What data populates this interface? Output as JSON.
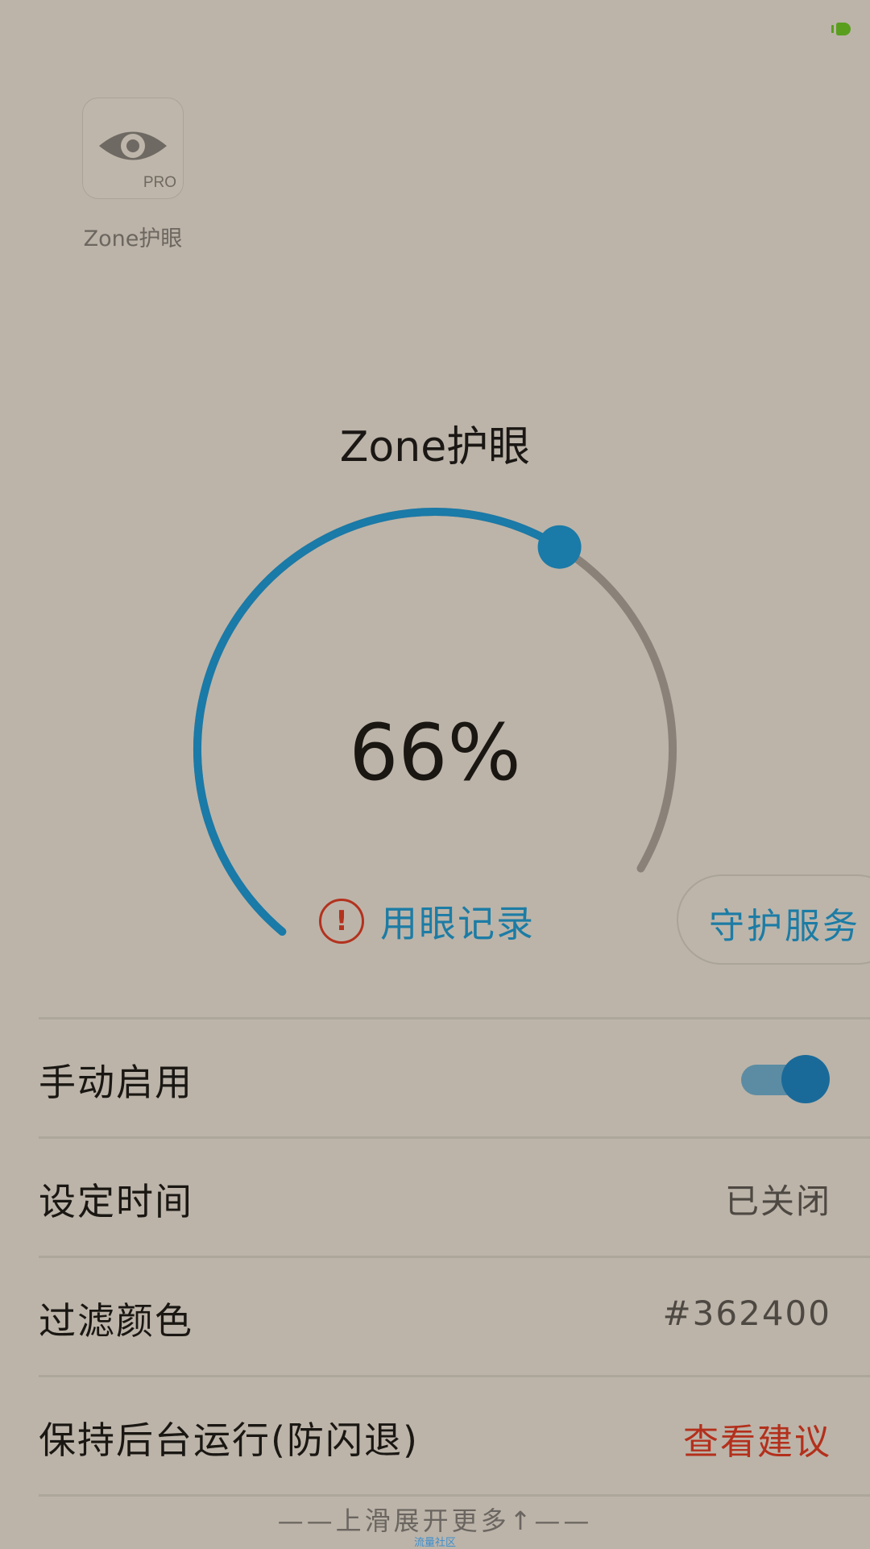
{
  "app": {
    "icon_badge": "PRO",
    "name": "Zone护眼"
  },
  "main": {
    "title": "Zone护眼",
    "percent_text": "66%",
    "level_fraction": 0.66,
    "record_label": "用眼记录",
    "guard_label": "守护服务"
  },
  "settings": {
    "manual": {
      "label": "手动启用",
      "enabled": true
    },
    "schedule": {
      "label": "设定时间",
      "value": "已关闭"
    },
    "filter": {
      "label": "过滤颜色",
      "value": "#362400"
    },
    "background": {
      "label": "保持后台运行(防闪退)",
      "value": "查看建议"
    }
  },
  "footer": {
    "hint": "——上滑展开更多↑——",
    "small": "流量社区"
  },
  "colors": {
    "background": "#bcb4a9",
    "accent_blue": "#1a7aa8",
    "track_gray": "#8a8279",
    "warning_red": "#b3321e",
    "toggle_on": "#1a6a99"
  },
  "icons": {
    "status": "battery-indicator-icon",
    "app": "eye-icon",
    "record": "exclamation-circle-icon"
  }
}
